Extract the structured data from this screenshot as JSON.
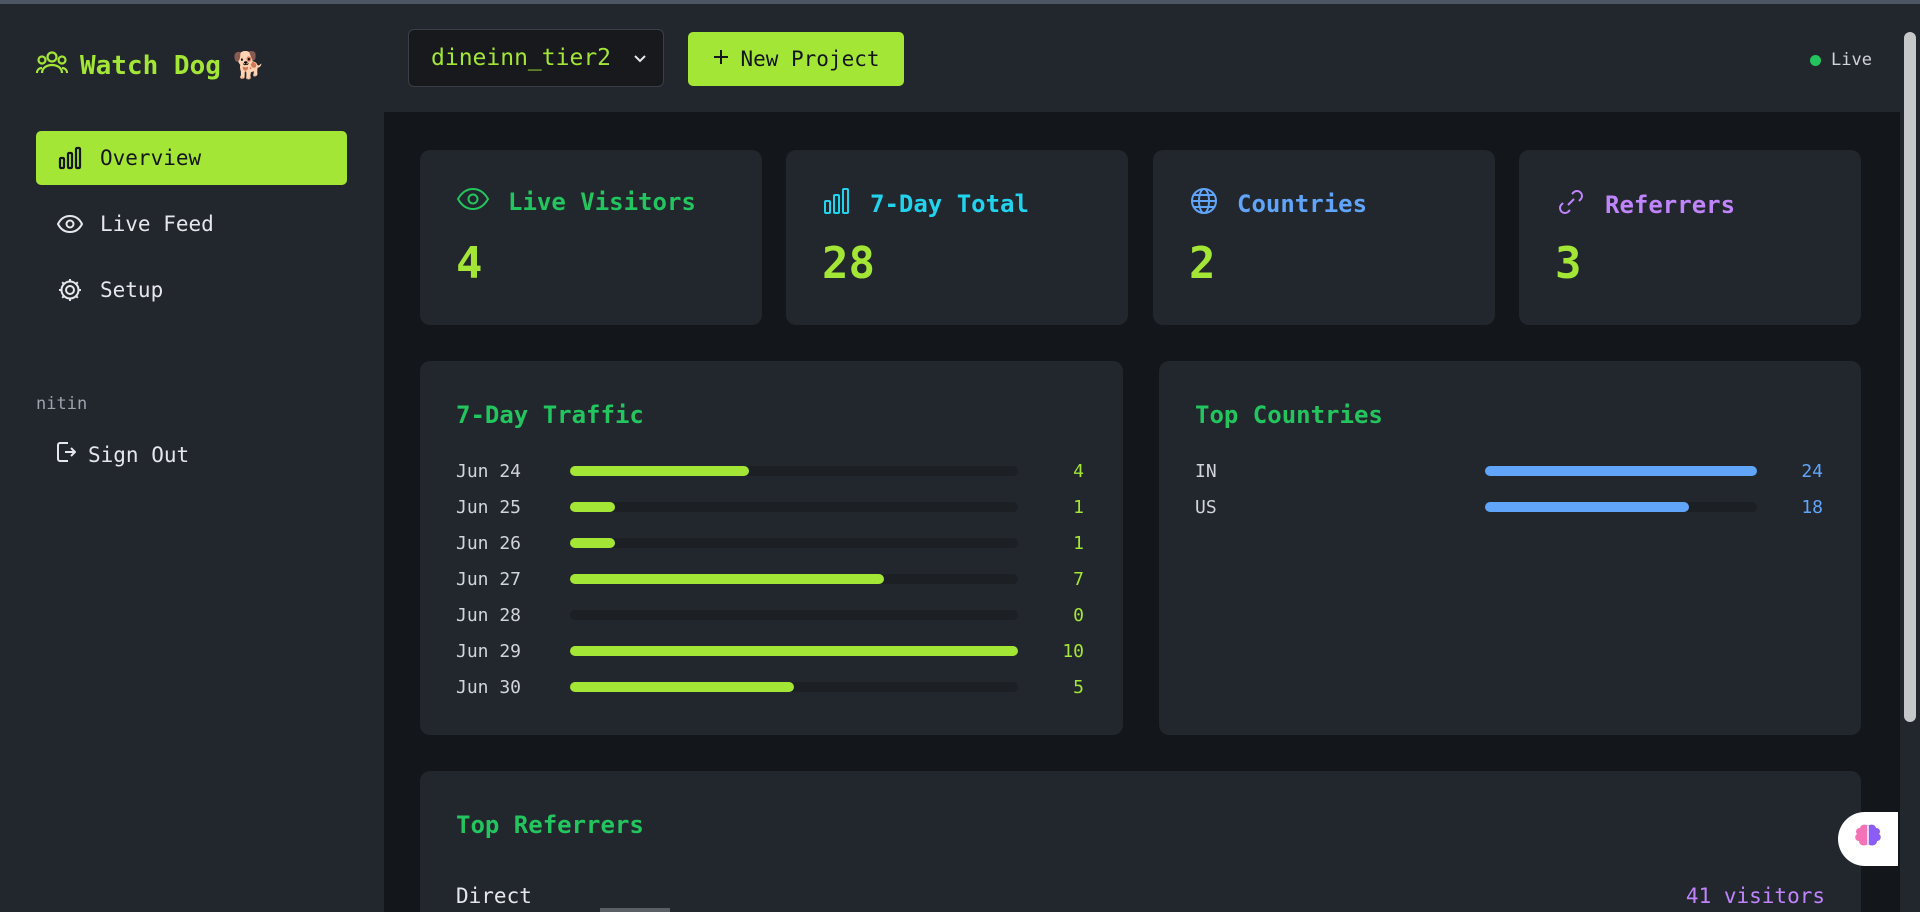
{
  "app": {
    "name": "Watch Dog",
    "emoji": "🐕"
  },
  "sidebar": {
    "items": [
      {
        "label": "Overview",
        "icon": "bar-chart-icon",
        "active": true
      },
      {
        "label": "Live Feed",
        "icon": "eye-icon",
        "active": false
      },
      {
        "label": "Setup",
        "icon": "gear-icon",
        "active": false
      }
    ],
    "user": "nitin",
    "signout_label": "Sign Out"
  },
  "header": {
    "project": "dineinn_tier2",
    "new_project_label": "New Project",
    "status": "Live"
  },
  "stats": [
    {
      "label": "Live Visitors",
      "value": "4",
      "icon": "eye-icon",
      "color": "#22c55e"
    },
    {
      "label": "7-Day Total",
      "value": "28",
      "icon": "bar-chart-icon",
      "color": "#22d3ee"
    },
    {
      "label": "Countries",
      "value": "2",
      "icon": "globe-icon",
      "color": "#60a5fa"
    },
    {
      "label": "Referrers",
      "value": "3",
      "icon": "link-icon",
      "color": "#c084fc"
    }
  ],
  "traffic": {
    "title": "7-Day Traffic",
    "max": 10,
    "rows": [
      {
        "label": "Jun 24",
        "value": 4
      },
      {
        "label": "Jun 25",
        "value": 1
      },
      {
        "label": "Jun 26",
        "value": 1
      },
      {
        "label": "Jun 27",
        "value": 7
      },
      {
        "label": "Jun 28",
        "value": 0
      },
      {
        "label": "Jun 29",
        "value": 10
      },
      {
        "label": "Jun 30",
        "value": 5
      }
    ]
  },
  "countries": {
    "title": "Top Countries",
    "max": 24,
    "rows": [
      {
        "label": "IN",
        "value": 24
      },
      {
        "label": "US",
        "value": 18
      }
    ]
  },
  "referrers": {
    "title": "Top Referrers",
    "rows": [
      {
        "label": "Direct",
        "count": "41 visitors"
      }
    ]
  }
}
